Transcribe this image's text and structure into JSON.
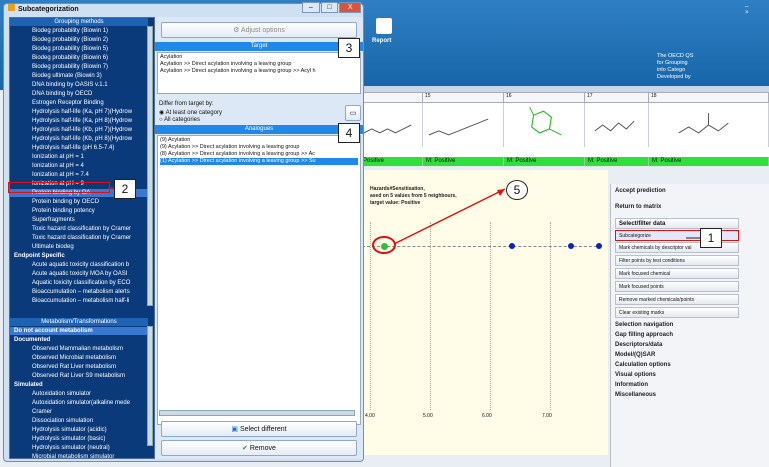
{
  "dialog": {
    "title": "Subcategorization",
    "win": {
      "min": "–",
      "max": "□",
      "close": "X"
    }
  },
  "groups": {
    "header": "Grouping methods",
    "items": [
      "Biodeg probability (Biowin 1)",
      "Biodeg probability (Biowin 2)",
      "Biodeg probability (Biowin 5)",
      "Biodeg probability (Biowin 6)",
      "Biodeg probability (Biowin 7)",
      "Biodeg ultimate (Biowin 3)",
      "DNA binding by OASIS v.1.1",
      "DNA binding by OECD",
      "Estrogen Receptor Binding",
      "Hydrolysis half-life (Ka, pH 7)(Hydrow",
      "Hydrolysis half-life (Ka, pH 8)(Hydrow",
      "Hydrolysis half-life (Kb, pH 7)(Hydrow",
      "Hydrolysis half-life (Kb, pH 8)(Hydrow",
      "Hydrolysis half-life (pH 6.5-7.4)",
      "Ionization at pH = 1",
      "Ionization at pH = 4",
      "Ionization at pH = 7.4",
      "Ionization at pH = 9",
      "Protein binding by OA",
      "Protein binding by OECD",
      "Protein binding potency",
      "Superfragments",
      "Toxic hazard classification by Cramer",
      "Toxic hazard classification by Cramer",
      "Ultimate biodeg",
      "Endpoint Specific",
      "Acute aquatic toxicity classification b",
      "Acute aquatic toxicity MOA by OASI",
      "Aquatic toxicity classification by ECO",
      "Bioaccumulation – metabolism alerts",
      "Bioaccumulation – metabolism half-li"
    ]
  },
  "metab": {
    "header": "Metabolism/Transformations",
    "items": [
      "Do not account metabolism",
      "Documented",
      "Observed Mammalian metabolism",
      "Observed Microbial metabolism",
      "Observed Rat Liver metabolism",
      "Observed Rat Liver S9 metabolism",
      "Simulated",
      "Autoxidation simulator",
      "Autoxidation simulator(alkaline mede",
      "Cramer",
      "Dissociation simulation",
      "Hydrolysis simulator (acidic)",
      "Hydrolysis simulator (basic)",
      "Hydrolysis simulator (neutral)",
      "Microbial metabolism simulator"
    ]
  },
  "mid": {
    "adjust": "Adjust options",
    "target_header": "Target",
    "target_lines": [
      "Acylation",
      "Acylation >> Direct acylation involving a leaving group",
      "Acylation >> Direct acylation involving a leaving group >> Acyl h"
    ],
    "differ_label": "Differ from target by:",
    "radio1": "At least one category",
    "radio2": "All categories",
    "analogues_header": "Analogues",
    "analogue_lines": [
      "(9) Acylation",
      "(9) Acylation >> Direct acylation involving a leaving group",
      "(8) Acylation >> Direct acylation involving a leaving group >> Ac",
      "(1) Acylation >> Direct acylation involving a leaving group >> Su"
    ],
    "select_different": "Select different",
    "remove": "Remove"
  },
  "app": {
    "report": "Report",
    "oecd_lines": [
      "The OECD QS",
      "for Grouping",
      "into Catego",
      "Developed by"
    ]
  },
  "grid": {
    "cols": [
      "15",
      "16",
      "17",
      "18"
    ],
    "predictions": [
      "Positive",
      "M: Positive",
      "M: Positive",
      "M: Positive",
      "M: Positive"
    ]
  },
  "chart": {
    "title_lines": [
      "Hazards#Sensitisation,",
      "ased on 5 values from 5 neighbours,",
      "target value: Positive"
    ],
    "xticks": [
      "4.00",
      "5.00",
      "6.00",
      "7.00"
    ]
  },
  "right": {
    "accept": "Accept prediction",
    "return": "Return to matrix",
    "select_filter": "Select/filter data",
    "buttons": [
      "Subcategorize",
      "Mark chemicals by descriptor val",
      "Filter points by test conditions",
      "Mark focused chemical",
      "Mark focused points",
      "Remove marked chemicals/points",
      "Clear existing marks"
    ],
    "sections": [
      "Selection navigation",
      "Gap filling approach",
      "Descriptors/data",
      "Model/(Q)SAR",
      "Calculation options",
      "Visual options",
      "Information",
      "Miscellaneous"
    ]
  },
  "callouts": [
    "1",
    "2",
    "3",
    "4",
    "5"
  ],
  "colors": {
    "accent": "#1f88e8",
    "list_bg": "#0b3a7a",
    "positive": "#2fe03a",
    "highlight": "#e01010"
  }
}
